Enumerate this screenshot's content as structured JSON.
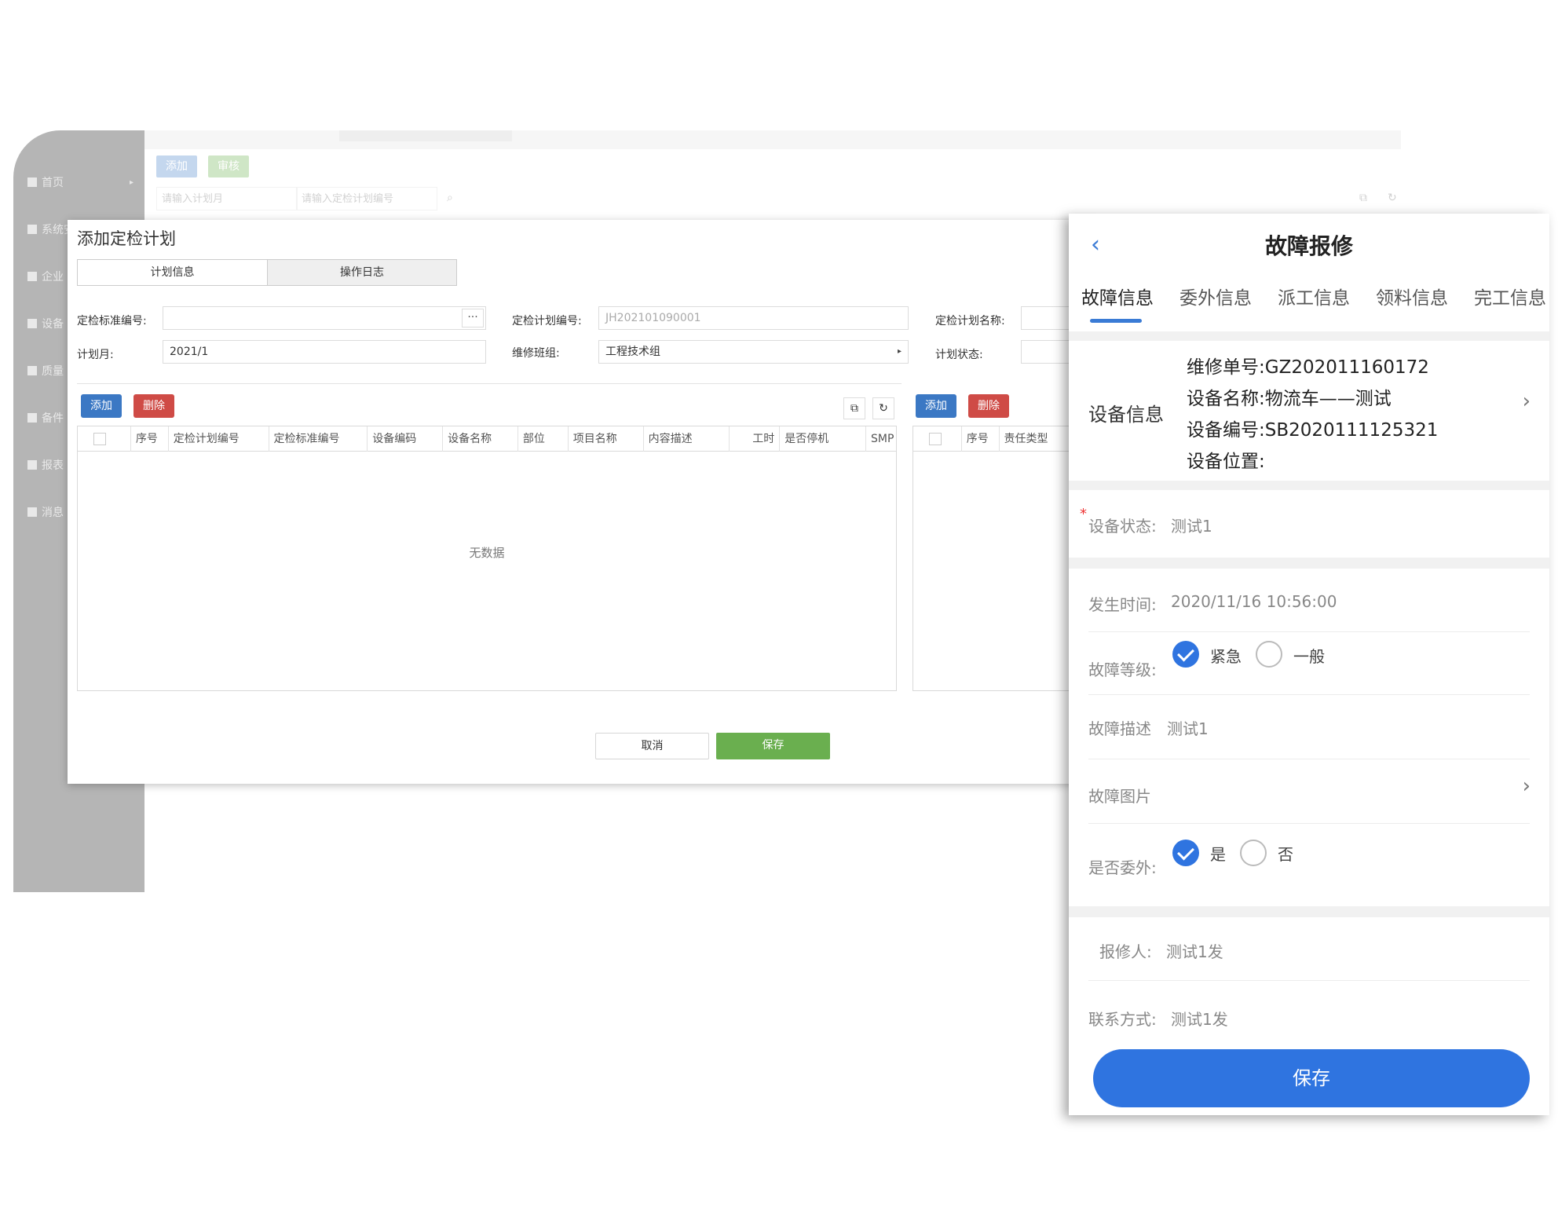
{
  "sidebar": {
    "items": [
      {
        "label": "首页"
      },
      {
        "label": "系统安全"
      },
      {
        "label": "企业"
      },
      {
        "label": "设备"
      },
      {
        "label": "质量"
      },
      {
        "label": "备件"
      },
      {
        "label": "报表"
      },
      {
        "label": "消息"
      }
    ]
  },
  "toolbar": {
    "add_label": "添加",
    "audit_label": "审核",
    "month_placeholder": "请输入计划月",
    "code_placeholder": "请输入定检计划编号"
  },
  "modal": {
    "title": "添加定检计划",
    "tabs": [
      "计划信息",
      "操作日志"
    ],
    "form": {
      "standard_code_label": "定检标准编号:",
      "standard_code_value": "",
      "dots": "···",
      "plan_code_label": "定检计划编号:",
      "plan_code_value": "JH202101090001",
      "plan_name_label": "定检计划名称:",
      "plan_month_label": "计划月:",
      "plan_month_value": "2021/1",
      "team_label": "维修班组:",
      "team_value": "工程技术组",
      "status_label": "计划状态:"
    },
    "left_table": {
      "add_label": "添加",
      "delete_label": "删除",
      "columns": [
        "序号",
        "定检计划编号",
        "定检标准编号",
        "设备编码",
        "设备名称",
        "部位",
        "项目名称",
        "内容描述",
        "工时",
        "是否停机",
        "SMP"
      ],
      "empty_text": "无数据"
    },
    "right_table": {
      "add_label": "添加",
      "delete_label": "删除",
      "columns": [
        "序号",
        "责任类型"
      ]
    },
    "cancel_label": "取消",
    "save_label": "保存"
  },
  "mobile": {
    "title": "故障报修",
    "tabs": [
      "故障信息",
      "委外信息",
      "派工信息",
      "领料信息",
      "完工信息"
    ],
    "device_info": {
      "label": "设备信息",
      "repair_no": "维修单号:GZ202011160172",
      "device_name": "设备名称:物流车——测试",
      "device_no": "设备编号:SB2020111125321",
      "device_location": "设备位置:"
    },
    "device_status": {
      "label": "设备状态:",
      "value": "测试1"
    },
    "occur_time": {
      "label": "发生时间:",
      "value": "2020/11/16 10:56:00"
    },
    "fault_level": {
      "label": "故障等级:",
      "option_urgent": "紧急",
      "option_normal": "一般",
      "selected": "紧急"
    },
    "fault_desc": {
      "label": "故障描述",
      "value": "测试1"
    },
    "fault_image": {
      "label": "故障图片"
    },
    "outsourced": {
      "label": "是否委外:",
      "option_yes": "是",
      "option_no": "否",
      "selected": "是"
    },
    "reporter": {
      "label": "报修人:",
      "value": "测试1发"
    },
    "contact": {
      "label": "联系方式:",
      "value": "测试1发"
    },
    "save_label": "保存"
  },
  "colors": {
    "primary_blue": "#2f74e0",
    "table_blue": "#3b78c4",
    "delete_red": "#cf4b46",
    "save_green": "#6aaf4f"
  }
}
